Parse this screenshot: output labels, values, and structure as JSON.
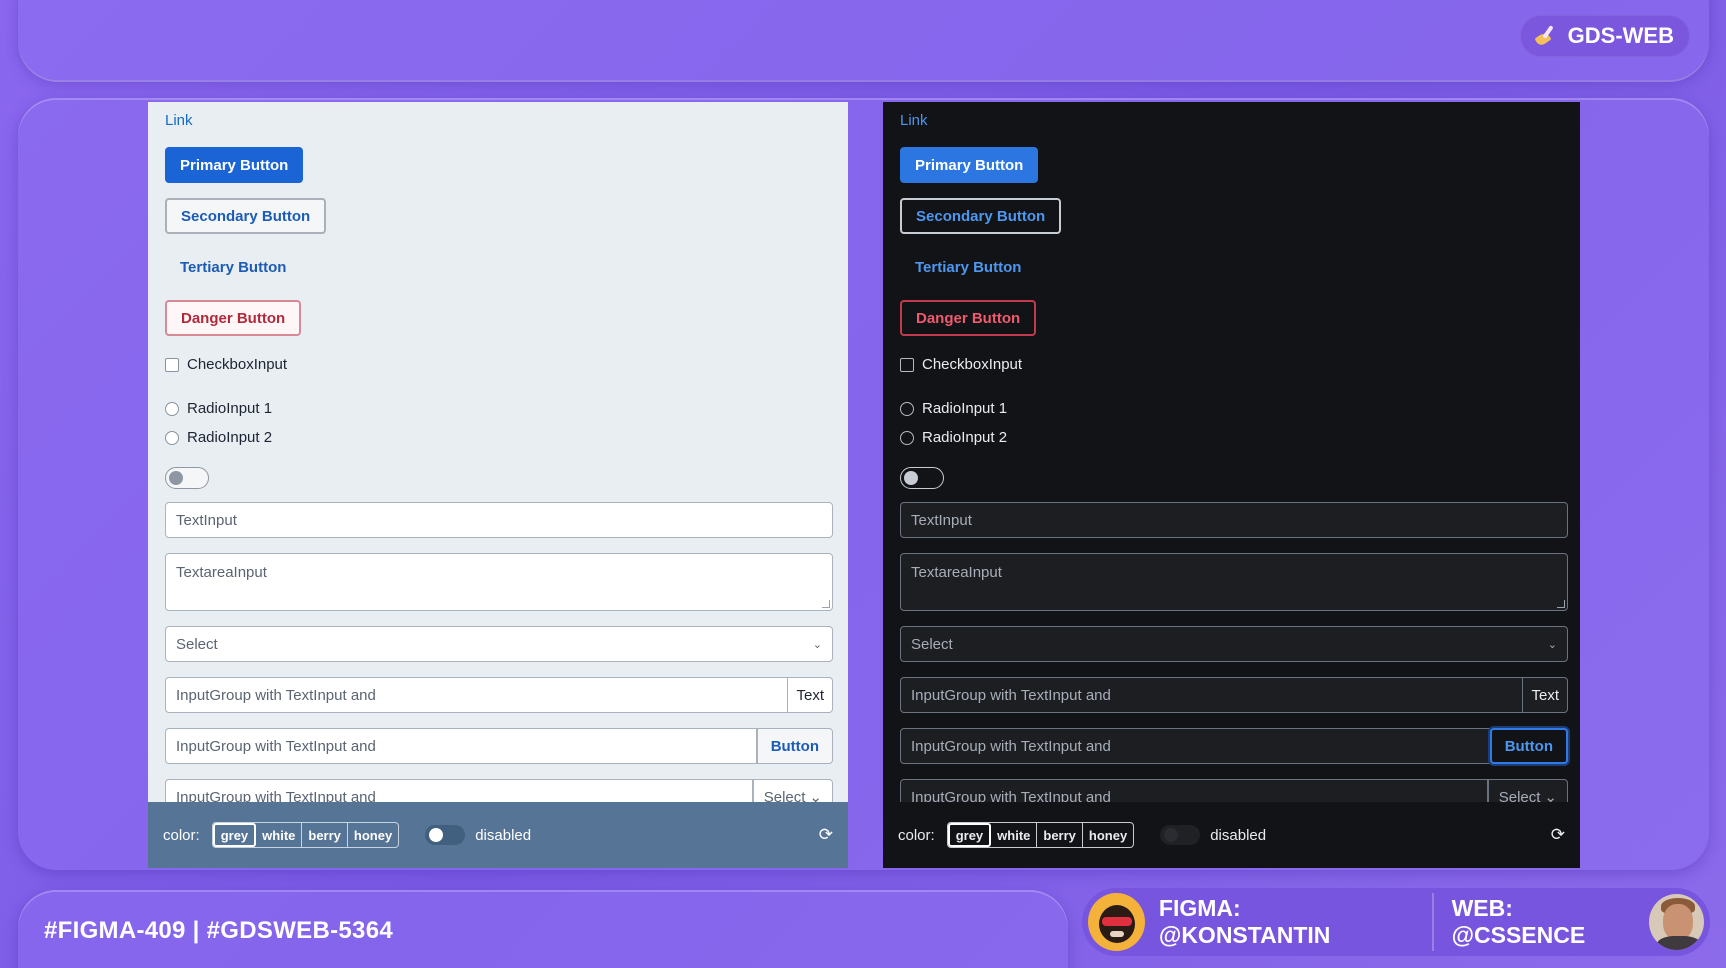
{
  "app": {
    "brand": "GDS-WEB"
  },
  "demo": {
    "link": "Link",
    "primary_button": "Primary Button",
    "secondary_button": "Secondary Button",
    "tertiary_button": "Tertiary Button",
    "danger_button": "Danger Button",
    "checkbox_label": "CheckboxInput",
    "radio_1": "RadioInput 1",
    "radio_2": "RadioInput 2",
    "text_input_placeholder": "TextInput",
    "textarea_placeholder": "TextareaInput",
    "select_value": "Select",
    "input_group_placeholder": "InputGroup with TextInput and",
    "ig_text_addon": "Text",
    "ig_button_addon": "Button",
    "ig_select_addon": "Select"
  },
  "controls": {
    "color_label": "color:",
    "color_options": [
      "grey",
      "white",
      "berry",
      "honey"
    ],
    "selected_color": "grey",
    "disabled_label": "disabled"
  },
  "footer": {
    "tickets": "#FIGMA-409 | #GDSWEB-5364",
    "figma_credit": "FIGMA: @KONSTANTIN",
    "web_credit": "WEB: @CSSENCE"
  },
  "icons": {
    "brand": "paintbrush-icon",
    "select": "chevron-down-icon",
    "refresh": "refresh-icon"
  },
  "colors": {
    "background": "#8a67ee",
    "primary": "#1a64d6",
    "danger": "#b02a3c",
    "light_bg": "#e9eef2",
    "dark_bg": "#121317",
    "ctrl_bar_light": "#567495"
  }
}
